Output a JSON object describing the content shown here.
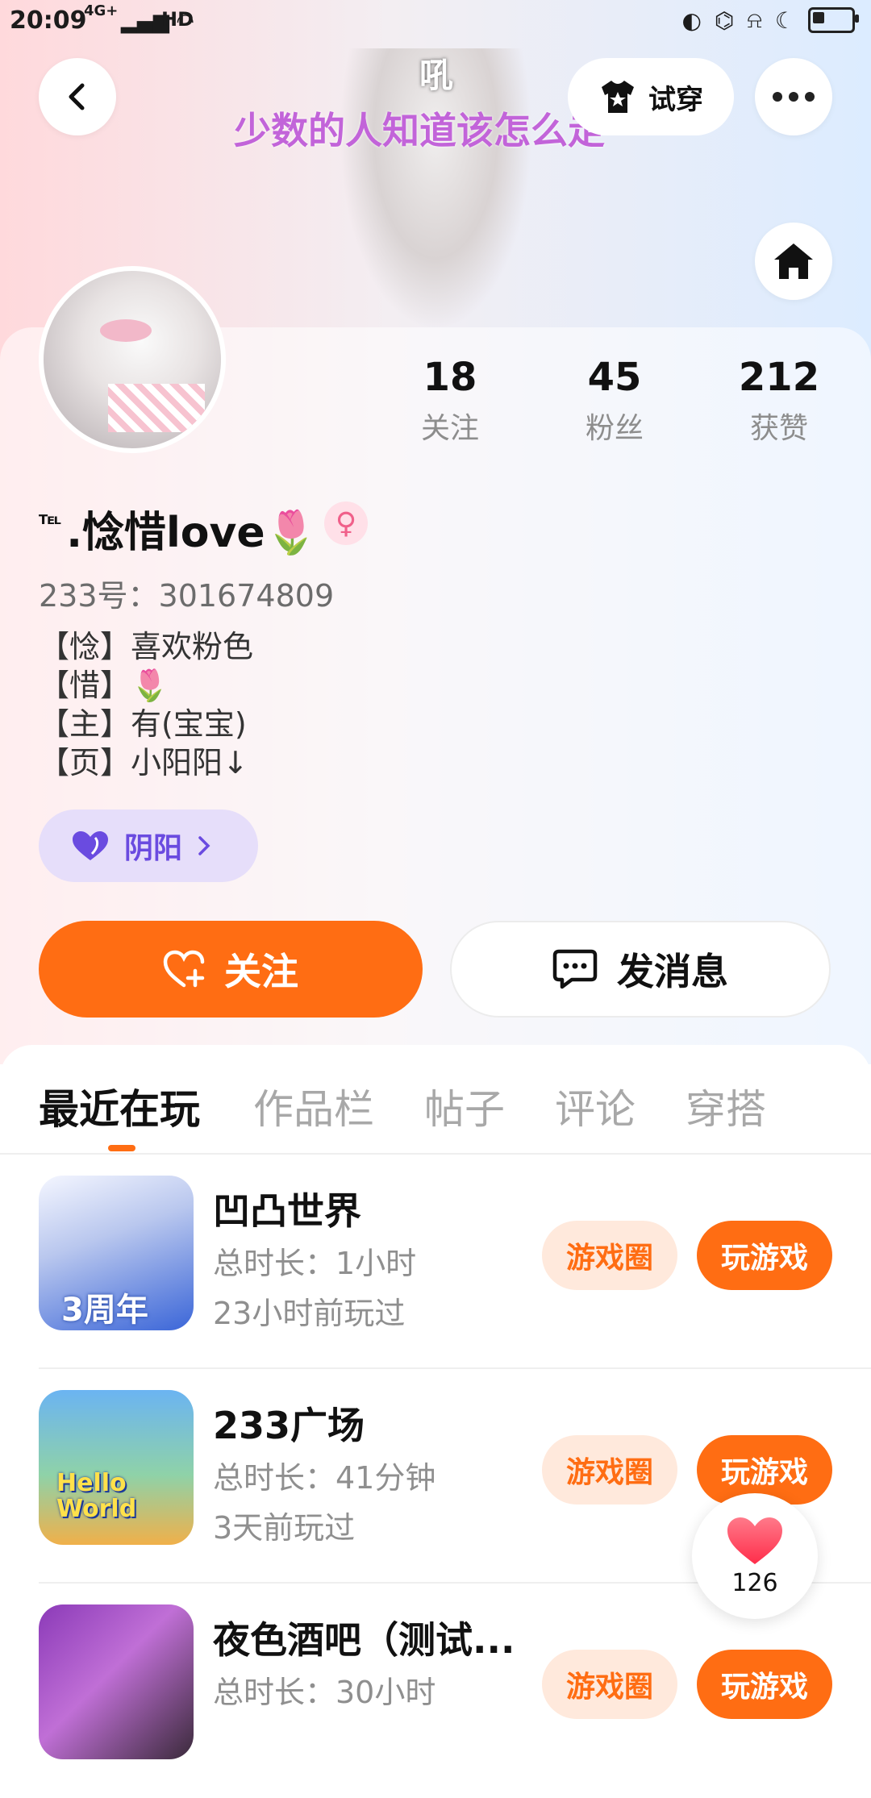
{
  "status_bar": {
    "time": "20:09",
    "network": "4G+",
    "hd": "HD",
    "battery_level": 0.35
  },
  "header": {
    "try_on_label": "试穿",
    "lyric_small": "吼",
    "lyric": "少数的人知道该怎么走"
  },
  "profile": {
    "stats": [
      {
        "value": "18",
        "label": "关注"
      },
      {
        "value": "45",
        "label": "粉丝"
      },
      {
        "value": "212",
        "label": "获赞"
      }
    ],
    "name_prefix": "℡",
    "name": ".惗惜love🌷",
    "gender_symbol": "♀",
    "uid": "233号：301674809",
    "bio": [
      "【惗】喜欢粉色",
      "【惜】🌷",
      "【主】有(宝宝)",
      "【页】小阳阳↓"
    ],
    "tag": "阴阳"
  },
  "actions": {
    "follow_label": "关注",
    "message_label": "发消息"
  },
  "tabs": [
    "最近在玩",
    "作品栏",
    "帖子",
    "评论",
    "穿搭"
  ],
  "games": [
    {
      "title": "凹凸世界",
      "duration": "总时长：1小时",
      "last_played": "23小时前玩过",
      "circle_label": "游戏圈",
      "play_label": "玩游戏",
      "icon_text": "3周年"
    },
    {
      "title": "233广场",
      "duration": "总时长：41分钟",
      "last_played": "3天前玩过",
      "circle_label": "游戏圈",
      "play_label": "玩游戏",
      "icon_text": "Hello World"
    },
    {
      "title": "夜色酒吧（测试...",
      "duration": "总时长：30小时",
      "last_played": "",
      "circle_label": "游戏圈",
      "play_label": "玩游戏",
      "icon_text": ""
    }
  ],
  "like_float": {
    "count": "126"
  },
  "colors": {
    "accent": "#ff6d13",
    "accent_light": "#ffe9dc",
    "tag_bg": "#e6defa",
    "tag_text": "#6a4be0"
  },
  "icons": [
    "chevron-left-icon",
    "shirt-icon",
    "more-icon",
    "home-icon",
    "female-icon",
    "heart-icon",
    "heart-add-icon",
    "chat-icon",
    "chevron-right-icon"
  ]
}
